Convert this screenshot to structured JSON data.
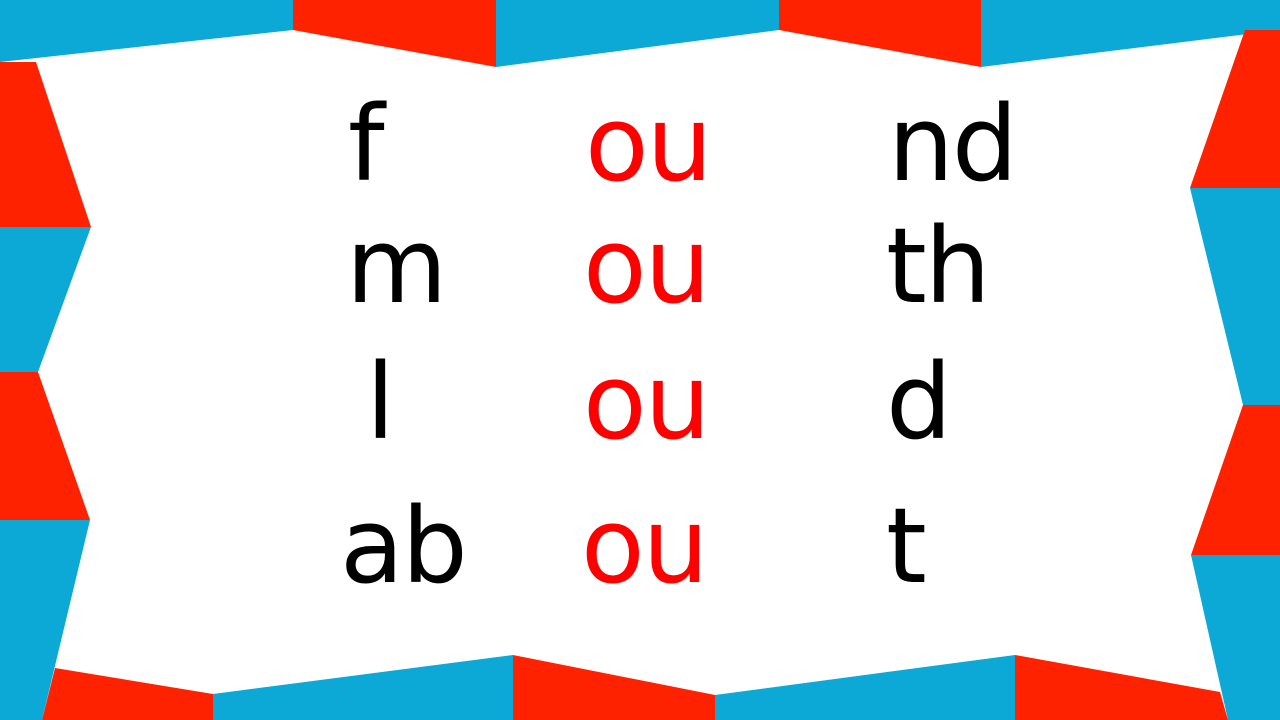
{
  "colors": {
    "red": "#ff2200",
    "blue": "#0ca9d6",
    "text": "#000000",
    "vowel": "#ff0000",
    "background": "#ffffff"
  },
  "words": [
    {
      "onset": "f",
      "vowel": "ou",
      "coda": "nd"
    },
    {
      "onset": "m",
      "vowel": "ou",
      "coda": "th"
    },
    {
      "onset": "l",
      "vowel": "ou",
      "coda": "d"
    },
    {
      "onset": "ab",
      "vowel": "ou",
      "coda": "t"
    }
  ]
}
